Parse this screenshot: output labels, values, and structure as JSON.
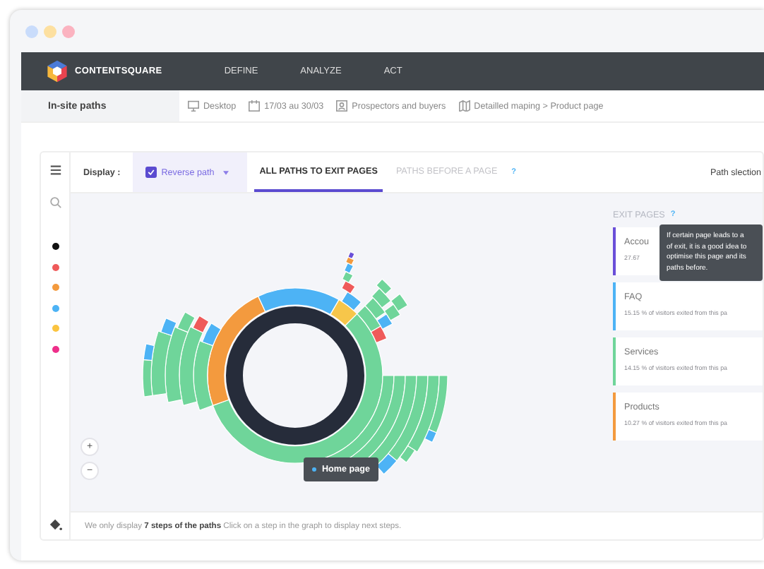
{
  "nav": {
    "brand": "CONTENTSQUARE",
    "items": [
      "DEFINE",
      "ANALYZE",
      "ACT"
    ]
  },
  "subbar": {
    "title": "In-site paths",
    "filters": [
      {
        "kind": "device",
        "label": "Desktop"
      },
      {
        "kind": "date",
        "label": "17/03 au 30/03"
      },
      {
        "kind": "segment",
        "label": "Prospectors and buyers"
      },
      {
        "kind": "mapping",
        "label": "Detailled maping > Product page"
      }
    ]
  },
  "toolbar": {
    "display_label": "Display :",
    "reverse_path": {
      "label": "Reverse path",
      "checked": true
    },
    "tabs": [
      {
        "label": "ALL PATHS TO EXIT PAGES",
        "selected": true
      },
      {
        "label": "PATHS BEFORE A PAGE",
        "selected": false
      }
    ],
    "help": "?",
    "path_selection": "Path slection"
  },
  "palette": [
    {
      "color": "#111111"
    },
    {
      "color": "#ef5a5a"
    },
    {
      "color": "#f39a3e"
    },
    {
      "color": "#4db3f5"
    },
    {
      "color": "#fbc440"
    },
    {
      "color": "#ee2f8a"
    }
  ],
  "zoom": {
    "in": "+",
    "out": "−"
  },
  "home_tooltip": "Home page",
  "exit_pages": {
    "title": "EXIT PAGES",
    "help": "?",
    "cards": [
      {
        "title": "Accou",
        "text": "27.67",
        "color": "#6a4fd8"
      },
      {
        "title": "FAQ",
        "text": "15.15 % of visitors exited from this pa",
        "color": "#4db3f5"
      },
      {
        "title": "Services",
        "text": "14.15 % of visitors exited from this pa",
        "color": "#6fd59a"
      },
      {
        "title": "Products",
        "text": "10.27 % of visitors exited from this pa",
        "color": "#f39a3e"
      }
    ],
    "tooltip": [
      "If certain page leads to a",
      "of exit, it is a good idea to",
      "optimise this page and its",
      "paths before."
    ]
  },
  "footer": "We only display **7 steps of the paths** Click on a step in the graph to display next steps."
}
